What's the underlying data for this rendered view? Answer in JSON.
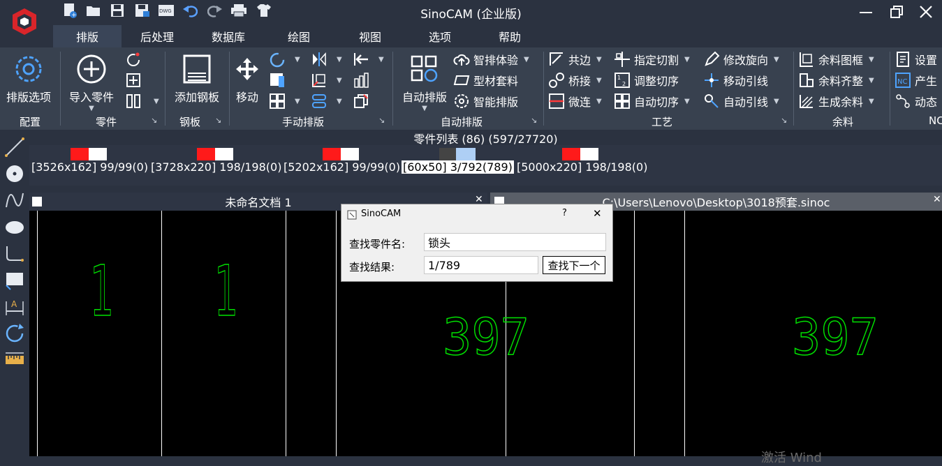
{
  "app": {
    "title": "SinoCAM (企业版)"
  },
  "menu_tabs": [
    "排版",
    "后处理",
    "数据库",
    "绘图",
    "视图",
    "选项",
    "帮助"
  ],
  "ribbon": {
    "config": {
      "button": "排版选项",
      "group": "配置"
    },
    "parts": {
      "button": "导入零件",
      "group": "零件"
    },
    "plate": {
      "button": "添加钢板",
      "group": "钢板"
    },
    "manual": {
      "button": "移动",
      "group": "手动排版"
    },
    "auto": {
      "button": "自动排版",
      "group": "自动排版",
      "items": [
        "智排体验",
        "型材套料",
        "智能排版"
      ]
    },
    "craft": {
      "group": "工艺",
      "col1": [
        "共边",
        "桥接",
        "微连"
      ],
      "col2": [
        "指定切割",
        "调整切序",
        "自动切序"
      ],
      "col3": [
        "修改旋向",
        "移动引线",
        "自动引线"
      ]
    },
    "remnant": {
      "group": "余料",
      "items": [
        "余料图框",
        "余料齐整",
        "生成余料"
      ]
    },
    "nc": {
      "group": "NC",
      "items": [
        "设置",
        "产生",
        "动态"
      ]
    }
  },
  "parts_list": {
    "header": "零件列表 (86) (597/27720)",
    "items": [
      {
        "label": "[3526x162] 99/99(0)",
        "selected": false
      },
      {
        "label": "[3728x220] 198/198(0)",
        "selected": false
      },
      {
        "label": "[5202x162] 99/99(0)",
        "selected": false
      },
      {
        "label": "[60x50] 3/792(789)",
        "selected": true
      },
      {
        "label": "[5000x220] 198/198(0)",
        "selected": false
      }
    ]
  },
  "documents": {
    "doc1": "未命名文档 1",
    "doc2": "C:\\Users\\Lenovo\\Desktop\\3018预套.sinoc"
  },
  "canvas": {
    "labels": [
      "1",
      "1",
      "397",
      "397"
    ],
    "line_color": "#00e000"
  },
  "dialog": {
    "title": "SinoCAM",
    "help": "?",
    "close": "✕",
    "name_label": "查找零件名:",
    "name_value": "锁头",
    "result_label": "查找结果:",
    "result_value": "1/789",
    "next_button": "查找下一个"
  },
  "watermark": "激活 Wind",
  "colors": {
    "accent_red": "#ff1a1a",
    "logo_red": "#d9252a",
    "ribbon_bg": "#38414f"
  }
}
